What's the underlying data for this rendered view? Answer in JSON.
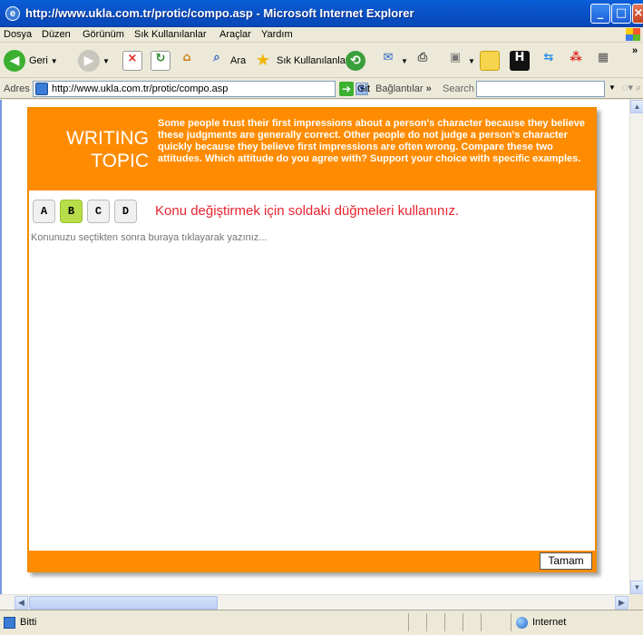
{
  "window": {
    "title": "http://www.ukla.com.tr/protic/compo.asp - Microsoft Internet Explorer"
  },
  "menu": [
    "Dosya",
    "Düzen",
    "Görünüm",
    "Sık Kullanılanlar",
    "Araçlar",
    "Yardım"
  ],
  "toolbar": {
    "back_label": "Geri",
    "search_label": "Ara",
    "favorites_label": "Sık Kullanılanlar"
  },
  "address": {
    "label": "Adres",
    "url": "http://www.ukla.com.tr/protic/compo.asp",
    "go_label": "Git",
    "links_label": "Bağlantılar",
    "search_label": "Search"
  },
  "page": {
    "heading_line1": "WRITING",
    "heading_line2": "TOPIC",
    "prompt": "Some people trust their first impressions about a person's character because they believe these judgments are generally correct. Other people do not judge a person's character quickly because they believe first impressions are often wrong. Compare these two attitudes. Which attitude do you agree with? Support your choice with specific examples.",
    "choices": [
      "A",
      "B",
      "C",
      "D"
    ],
    "selected_choice": "B",
    "hint": "Konu değiştirmek için soldaki düğmeleri kullanınız.",
    "answer_placeholder": "Konunuzu seçtikten sonra buraya tıklayarak yazınız...",
    "ok_label": "Tamam"
  },
  "status": {
    "text": "Bitti",
    "zone": "Internet"
  },
  "colors": {
    "panel_orange": "#ff8c00",
    "selected_green": "#b7dd49",
    "hint_red": "#e8232f",
    "xp_blue": "#0a5fd8"
  }
}
